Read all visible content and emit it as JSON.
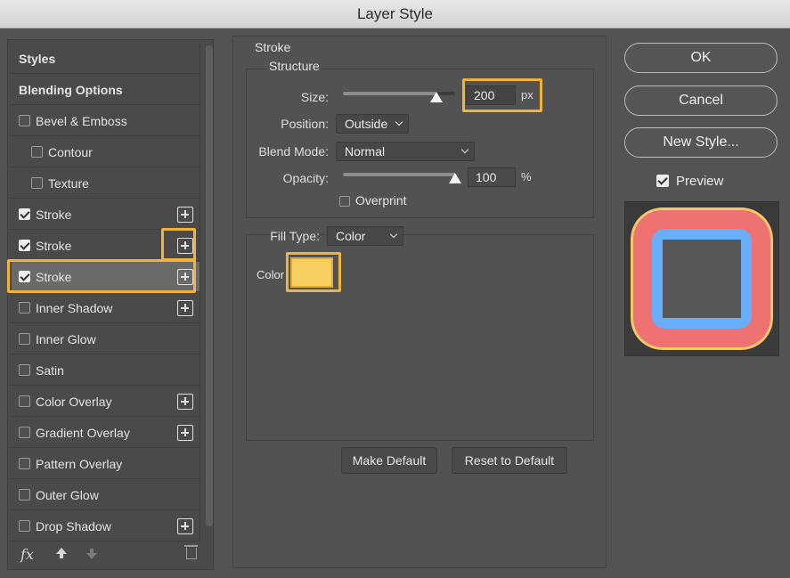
{
  "window": {
    "title": "Layer Style"
  },
  "styles_list": {
    "items": [
      {
        "label": "Styles",
        "type": "header"
      },
      {
        "label": "Blending Options",
        "type": "header"
      },
      {
        "label": "Bevel & Emboss",
        "checked": false
      },
      {
        "label": "Contour",
        "checked": false,
        "indent": true
      },
      {
        "label": "Texture",
        "checked": false,
        "indent": true
      },
      {
        "label": "Stroke",
        "checked": true,
        "plus": true
      },
      {
        "label": "Stroke",
        "checked": true,
        "plus": true
      },
      {
        "label": "Stroke",
        "checked": true,
        "plus": true,
        "selected": true
      },
      {
        "label": "Inner Shadow",
        "checked": false,
        "plus": true
      },
      {
        "label": "Inner Glow",
        "checked": false
      },
      {
        "label": "Satin",
        "checked": false
      },
      {
        "label": "Color Overlay",
        "checked": false,
        "plus": true
      },
      {
        "label": "Gradient Overlay",
        "checked": false,
        "plus": true
      },
      {
        "label": "Pattern Overlay",
        "checked": false
      },
      {
        "label": "Outer Glow",
        "checked": false
      },
      {
        "label": "Drop Shadow",
        "checked": false,
        "plus": true
      }
    ],
    "tools": {
      "fx_label": "fx"
    }
  },
  "stroke": {
    "title": "Stroke",
    "structure_title": "Structure",
    "size_label": "Size:",
    "size_value": "200",
    "size_unit": "px",
    "size_slider_fraction": 0.83,
    "position_label": "Position:",
    "position_value": "Outside",
    "blend_label": "Blend Mode:",
    "blend_value": "Normal",
    "opacity_label": "Opacity:",
    "opacity_value": "100",
    "opacity_unit": "%",
    "opacity_slider_fraction": 1.0,
    "overprint_label": "Overprint",
    "fill_type_label": "Fill Type:",
    "fill_type_value": "Color",
    "color_label": "Color",
    "color_value": "#f6cf60"
  },
  "buttons": {
    "make_default": "Make Default",
    "reset_default": "Reset to Default",
    "ok": "OK",
    "cancel": "Cancel",
    "new_style": "New Style...",
    "preview": "Preview"
  },
  "preview_colors": {
    "outer": "#f3c865",
    "middle": "#ee7272",
    "inner": "#69aefa"
  },
  "highlight_color": "#f0b33c"
}
